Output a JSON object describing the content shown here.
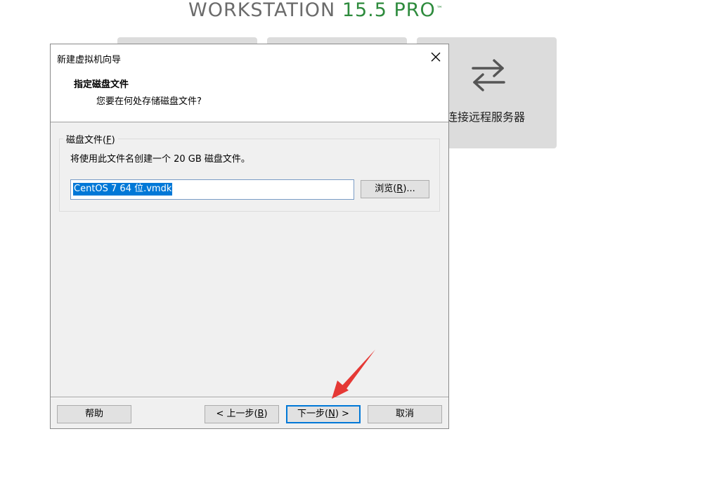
{
  "background": {
    "brand_workstation": "WORKSTATION ",
    "brand_version": "15.5 PRO",
    "brand_tm": "™",
    "tile3_label": "连接远程服务器"
  },
  "dialog": {
    "title": "新建虚拟机向导",
    "header_title": "指定磁盘文件",
    "header_subtitle": "您要在何处存储磁盘文件?",
    "group_label_prefix": "磁盘文件(",
    "group_label_key": "F",
    "group_label_suffix": ")",
    "description": "将使用此文件名创建一个 20 GB 磁盘文件。",
    "file_value": "CentOS 7 64 位.vmdk",
    "browse_prefix": "浏览(",
    "browse_key": "R",
    "browse_suffix": ")...",
    "help_label": "帮助",
    "back_prefix": "< 上一步(",
    "back_key": "B",
    "back_suffix": ")",
    "next_prefix": "下一步(",
    "next_key": "N",
    "next_suffix": ") >",
    "cancel_label": "取消"
  },
  "colors": {
    "accent": "#0078d7",
    "brand_green": "#2e8b3d",
    "annotation_red": "#e53935"
  }
}
